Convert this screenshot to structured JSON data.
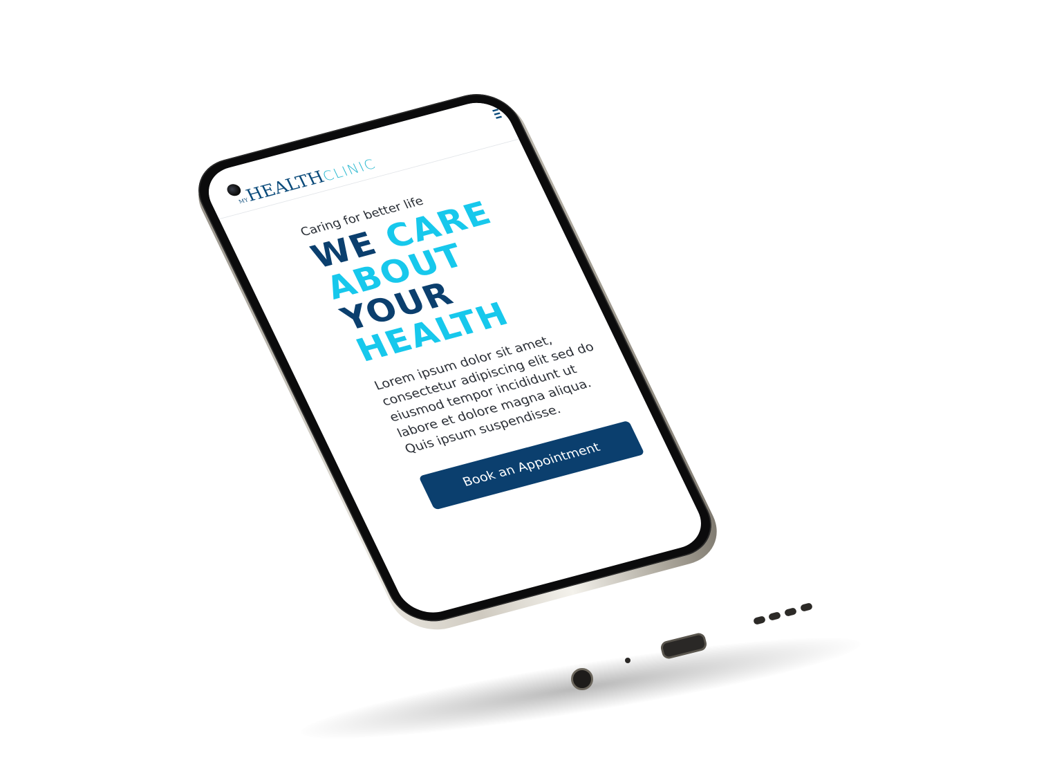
{
  "header": {
    "logo": {
      "prefix": "MY",
      "primary": "HEALTH",
      "secondary": "CLINIC"
    }
  },
  "hero": {
    "tagline": "Caring for better life",
    "headline": {
      "word1": "WE",
      "word2": "CARE",
      "word3": "ABOUT",
      "word4": "YOUR",
      "word5": "HEALTH"
    },
    "body": "Lorem ipsum dolor sit amet, consectetur adipiscing elit sed do eiusmod tempor incididunt ut labore et dolore magna aliqua. Quis ipsum suspendisse.",
    "cta_label": "Book an Appointment"
  },
  "colors": {
    "brand_dark": "#0b3f6e",
    "brand_cyan": "#17c8ec",
    "logo_cyan": "#26b7cf",
    "background": "#ffffff"
  },
  "icons": {
    "menu": "menu-icon",
    "camera": "camera-icon"
  }
}
